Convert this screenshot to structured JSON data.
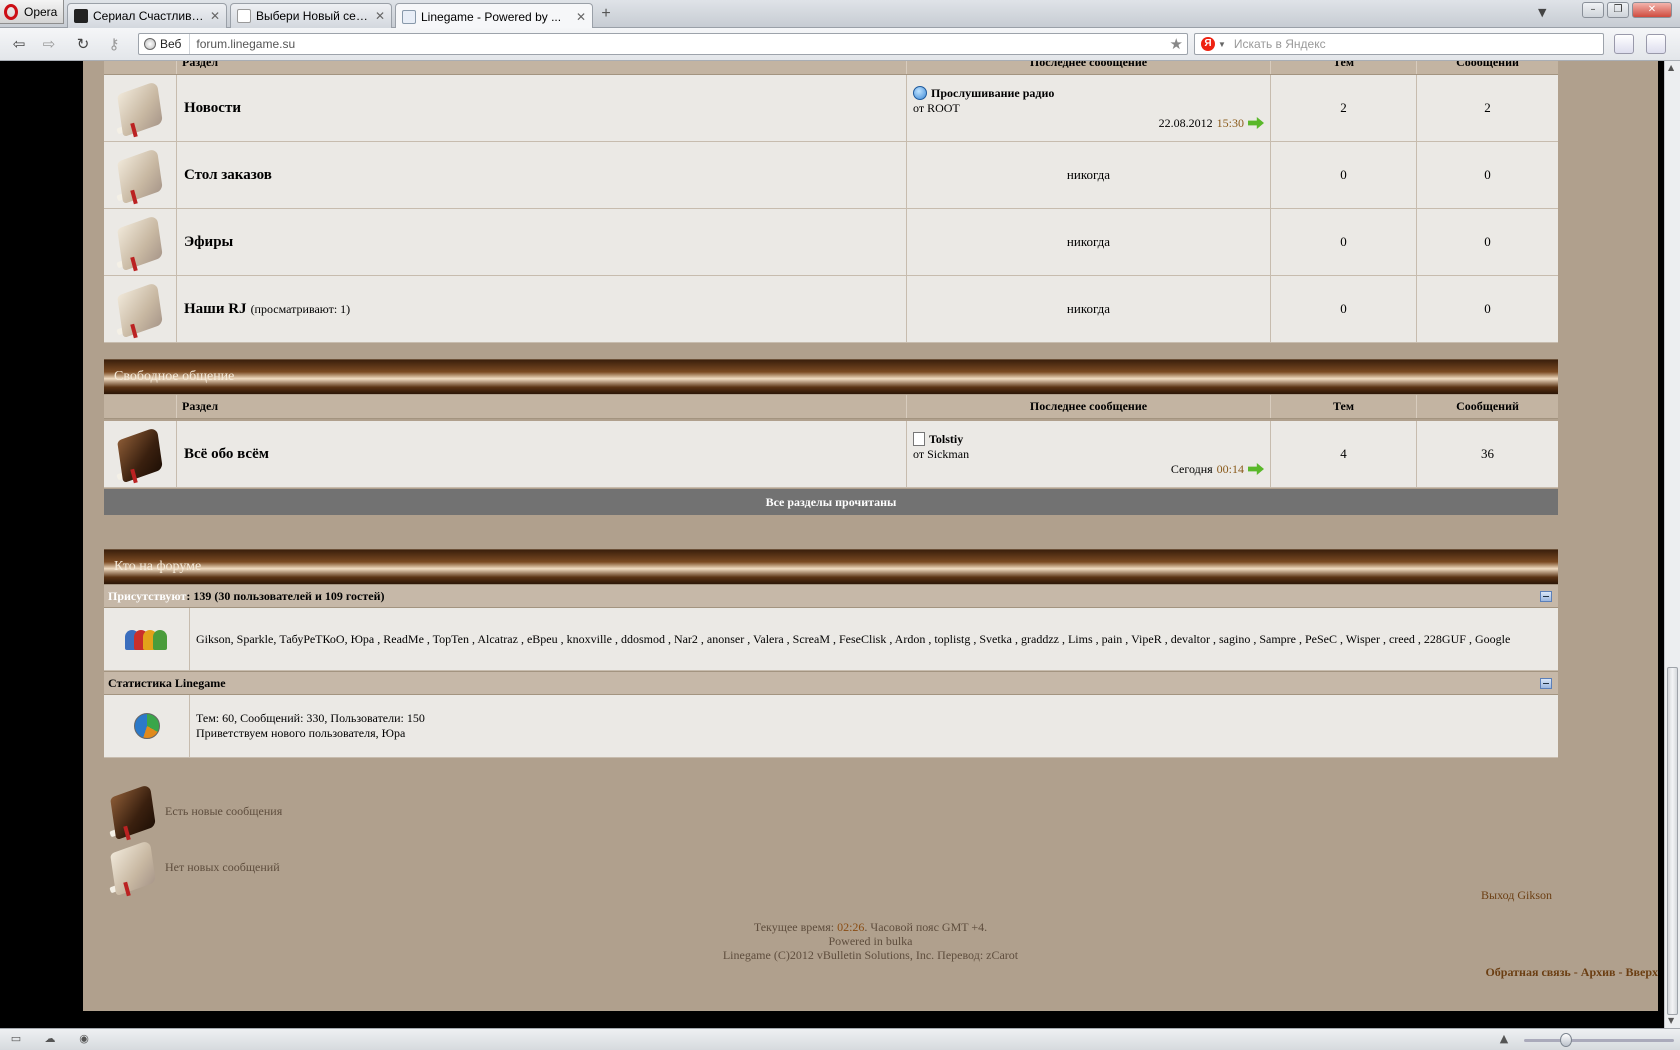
{
  "browser": {
    "app_name": "Opera",
    "tabs": [
      {
        "title": "Сериал Счастливы вне...",
        "icon": "cat-icon",
        "active": false
      },
      {
        "title": "Выбери Новый сервер L...",
        "icon": "search-page-icon",
        "active": false
      },
      {
        "title": "Linegame - Powered by ...",
        "icon": "page-icon",
        "active": true
      }
    ],
    "address": {
      "web_label": "Веб",
      "url": "forum.linegame.su"
    },
    "search": {
      "placeholder": "Искать в Яндекс",
      "engine_letter": "Я"
    }
  },
  "forum": {
    "col_headers": {
      "section": "Раздел",
      "last_post": "Последнее сообщение",
      "threads": "Тем",
      "posts": "Сообщений"
    },
    "top_forums": [
      {
        "name": "Новости",
        "extra": "",
        "last_title": "Прослушивание радио",
        "last_by": "от ROOT",
        "last_date": "22.08.2012",
        "last_time": "15:30",
        "never": "",
        "threads": "2",
        "posts": "2",
        "icon": "book-read-icon"
      },
      {
        "name": "Стол заказов",
        "extra": "",
        "last_title": "",
        "last_by": "",
        "last_date": "",
        "last_time": "",
        "never": "никогда",
        "threads": "0",
        "posts": "0",
        "icon": "book-read-icon"
      },
      {
        "name": "Эфиры",
        "extra": "",
        "last_title": "",
        "last_by": "",
        "last_date": "",
        "last_time": "",
        "never": "никогда",
        "threads": "0",
        "posts": "0",
        "icon": "book-read-icon"
      },
      {
        "name": "Наши RJ",
        "extra": "(просматривают: 1)",
        "last_title": "",
        "last_by": "",
        "last_date": "",
        "last_time": "",
        "never": "никогда",
        "threads": "0",
        "posts": "0",
        "icon": "book-read-icon"
      }
    ],
    "category_free": {
      "title": "Свободное общение",
      "forums": [
        {
          "name": "Всё обо всём",
          "last_title": "Tolstiy",
          "last_by": "от Sickman",
          "last_date": "Сегодня",
          "last_time": "00:14",
          "threads": "4",
          "posts": "36",
          "icon": "book-unread-icon"
        }
      ]
    },
    "all_read": "Все разделы прочитаны",
    "whos_online": {
      "title": "Кто на форуме",
      "present_label": "Присутствуют",
      "present_count": ": 139 (30 пользователей и 109 гостей)",
      "users": "Gikson, Sparkle, ТабуРеТКоО, Юра , ReadMe , TopTen , Alcatraz , eBpeu , knoxville , ddosmod , Nar2 , anonser , Valera , ScreaM , FeseClisk , Ardon , toplistg , Svetka , graddzz , Lims , pain , VipeR , devaltor , sagino , Sampre , PeSeC , Wisper , creed , 228GUF , Google"
    },
    "stats": {
      "title": "Статистика Linegame",
      "line1": "Тем: 60, Сообщений: 330, Пользователи: 150",
      "line2": "Приветствуем нового пользователя, Юра"
    },
    "legend": {
      "new_posts": "Есть новые сообщения",
      "no_new_posts": "Нет новых сообщений"
    },
    "logout": "Выход Gikson",
    "footer": {
      "time_prefix": "Текущее время: ",
      "time": "02:26",
      "time_suffix": ". Часовой пояс GMT +4.",
      "powered": "Powered in bulka",
      "copyright": "Linegame (C)2012 vBulletin Solutions, Inc. Перевод: zCarot"
    },
    "bottom_links": {
      "feedback": "Обратная связь",
      "archive": "Архив",
      "top": "Вверх",
      "sep": " - "
    }
  }
}
